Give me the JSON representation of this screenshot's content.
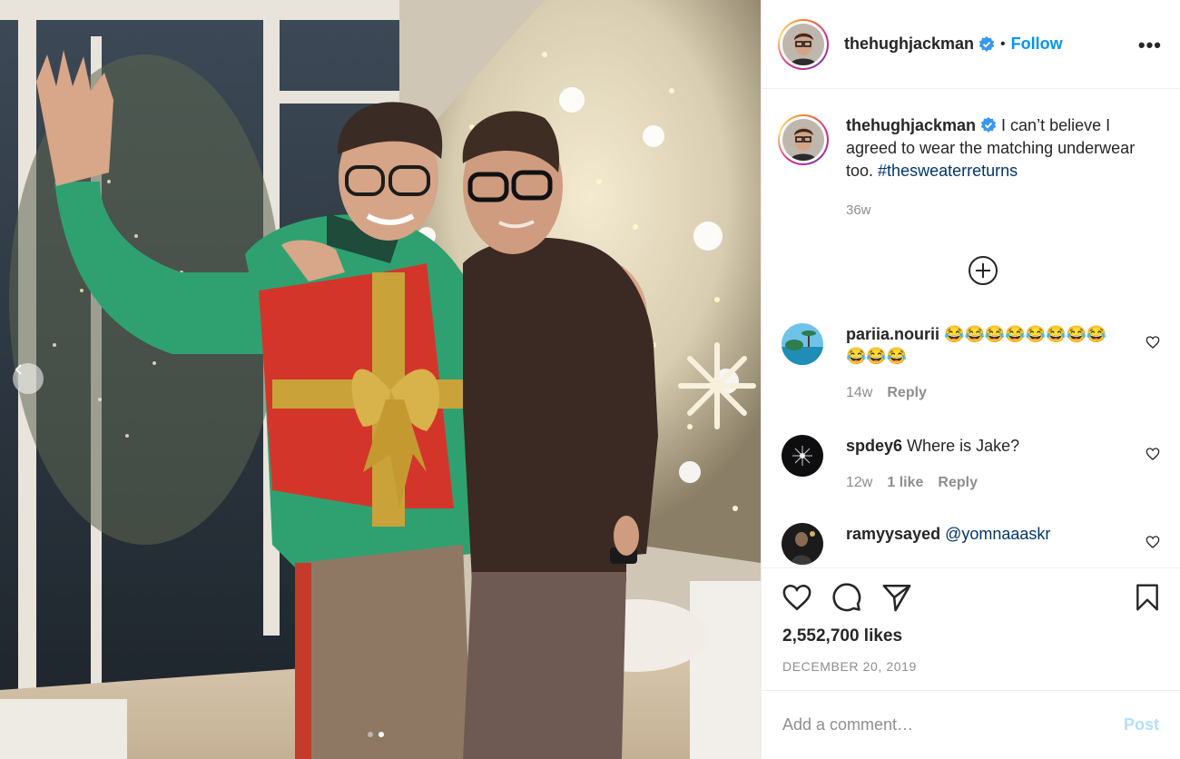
{
  "post": {
    "author": "thehughjackman",
    "follow_label": "Follow",
    "separator": "•",
    "more_label": "•••",
    "caption": "I can’t believe I agreed to wear the matching underwear too.",
    "hashtag": "#thesweaterreturns",
    "caption_time": "36w",
    "likes": "2,552,700 likes",
    "date": "DECEMBER 20, 2019"
  },
  "comments": [
    {
      "user": "pariia.nourii",
      "text": "😂😂😂😂😂😂😂😂😂😂😂",
      "time": "14w",
      "likes": "",
      "reply": "Reply"
    },
    {
      "user": "spdey6",
      "text": "Where is Jake?",
      "time": "12w",
      "likes": "1 like",
      "reply": "Reply"
    },
    {
      "user": "ramyysayed",
      "text": "@yomnaaaskr",
      "time": "",
      "likes": "",
      "reply": ""
    }
  ],
  "composer": {
    "placeholder": "Add a comment…",
    "post_label": "Post"
  },
  "colors": {
    "accent": "#0095f6",
    "verified": "#3897f0",
    "hashtag": "#00376b",
    "muted": "#8e8e8e",
    "post_disabled": "#b2dffc"
  },
  "icons": [
    "verified-badge-icon",
    "plus-circle-icon",
    "heart-icon",
    "comment-icon",
    "share-icon",
    "bookmark-icon",
    "chevron-left-icon"
  ],
  "carousel": {
    "slides": 2,
    "active": 2
  }
}
